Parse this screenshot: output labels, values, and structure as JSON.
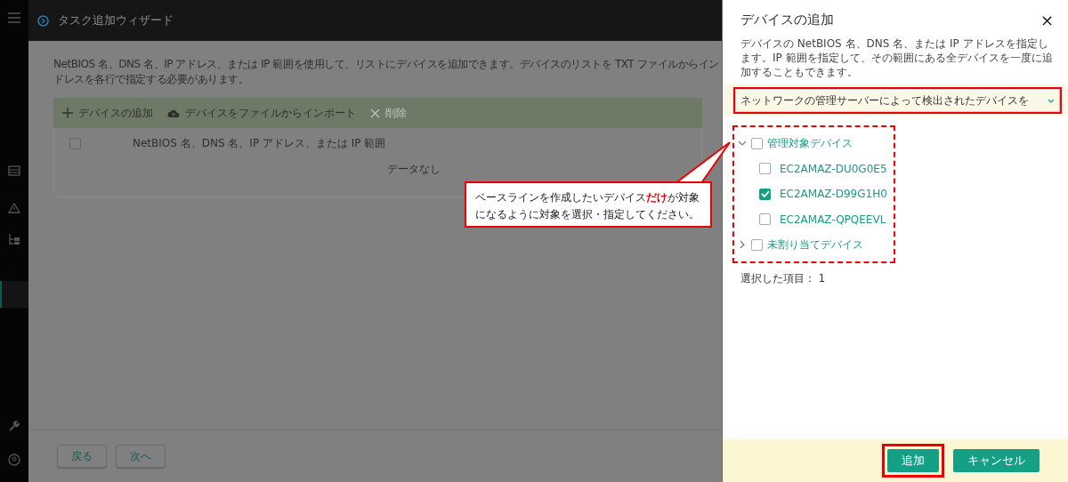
{
  "wizard": {
    "title": "タスク追加ウィザード",
    "description_lines": [
      "NetBIOS 名、DNS 名、IP アドレス、または IP 範囲を使用して、リストにデバイスを追加できます。デバイスのリストを TXT ファイルからイン",
      "ドレスを各行で指定する必要があります。"
    ],
    "toolbar": [
      {
        "kind": "add",
        "label": "デバイスの追加",
        "disabled": false
      },
      {
        "kind": "import",
        "label": "デバイスをファイルからインポート",
        "disabled": false
      },
      {
        "kind": "delete",
        "label": "削除",
        "disabled": true
      }
    ],
    "table": {
      "select_all_checked": false,
      "column_header": "NetBIOS 名、DNS 名、IP アドレス、または IP 範囲",
      "empty_text": "データなし"
    },
    "buttons": [
      "戻る",
      "次へ"
    ]
  },
  "panel": {
    "title": "デバイスの追加",
    "close": "×",
    "description": "デバイスの NetBIOS 名、DNS 名、または IP アドレスを指定します。IP 範囲を指定して、その範囲にある全デバイスを一度に追加することもできます。",
    "source_select": {
      "value": "ネットワークの管理サーバーによって検出されたデバイスを"
    },
    "tree": [
      {
        "label": "管理対象デバイス",
        "checked": false,
        "expanded": true,
        "children": [
          {
            "label": "EC2AMAZ-DU0G0E5",
            "checked": false
          },
          {
            "label": "EC2AMAZ-D99G1H0",
            "checked": true
          },
          {
            "label": "EC2AMAZ-QPQEEVL",
            "checked": false
          }
        ]
      },
      {
        "label": "未割り当てデバイス",
        "checked": false,
        "expanded": false
      }
    ],
    "selected_count": "選択した項目： 1",
    "buttons": [
      {
        "label": "追加",
        "highlighted": true
      },
      {
        "label": "キャンセル",
        "highlighted": false
      }
    ]
  },
  "callout": {
    "text": "ベースラインを作成したいデバイス**だけ**が対象になるように対象を選択・指定してください。"
  }
}
